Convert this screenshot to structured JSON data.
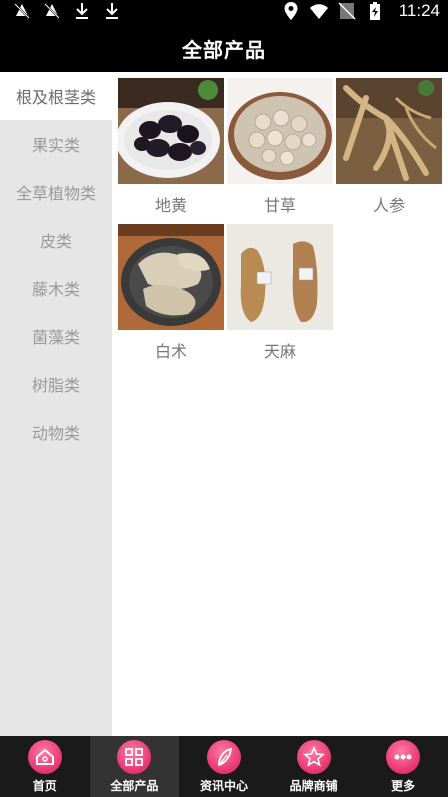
{
  "status": {
    "time": "11:24",
    "left_icons": [
      "muted-bell-icon",
      "muted-bell-icon",
      "download-icon",
      "download-icon"
    ],
    "right_icons": [
      "location-icon",
      "wifi-icon",
      "no-sim-icon",
      "battery-icon"
    ]
  },
  "header": {
    "title": "全部产品"
  },
  "sidebar": {
    "items": [
      {
        "label": "根及根茎类",
        "active": true
      },
      {
        "label": "果实类"
      },
      {
        "label": "全草植物类"
      },
      {
        "label": "皮类"
      },
      {
        "label": "藤木类"
      },
      {
        "label": "菌藻类"
      },
      {
        "label": "树脂类"
      },
      {
        "label": "动物类"
      }
    ]
  },
  "products": [
    {
      "name": "地黄"
    },
    {
      "name": "甘草"
    },
    {
      "name": "人参"
    },
    {
      "name": "白术"
    },
    {
      "name": "天麻"
    }
  ],
  "tabbar": {
    "tabs": [
      {
        "label": "首页",
        "icon": "home-icon"
      },
      {
        "label": "全部产品",
        "icon": "grid-icon",
        "active": true
      },
      {
        "label": "资讯中心",
        "icon": "leaf-icon"
      },
      {
        "label": "品牌商铺",
        "icon": "star-icon"
      },
      {
        "label": "更多",
        "icon": "more-icon"
      }
    ]
  },
  "colors": {
    "tab_accent": "#e6336e",
    "sidebar_bg": "#e6e6e6",
    "bar_bg": "#000000"
  }
}
